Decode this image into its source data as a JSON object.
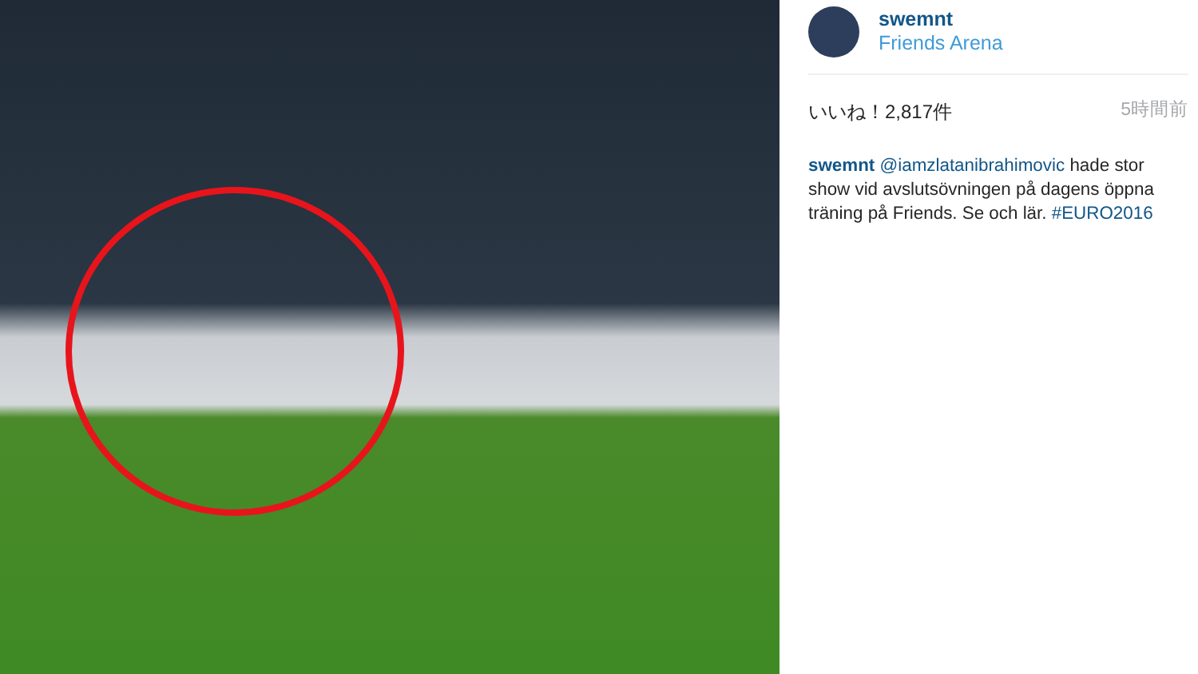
{
  "post": {
    "username": "swemnt",
    "location": "Friends Arena",
    "likes": "いいね！2,817件",
    "time": "5時間前",
    "caption": [
      {
        "kind": "user",
        "text": "swemnt"
      },
      {
        "kind": "mention",
        "text": "@iamzlatanibrahimovic"
      },
      {
        "kind": "text",
        "text": "hade stor show vid avslutsövningen på dagens öppna träning på Friends. Se och lär."
      },
      {
        "kind": "hashtag",
        "text": "#EURO2016"
      }
    ]
  }
}
